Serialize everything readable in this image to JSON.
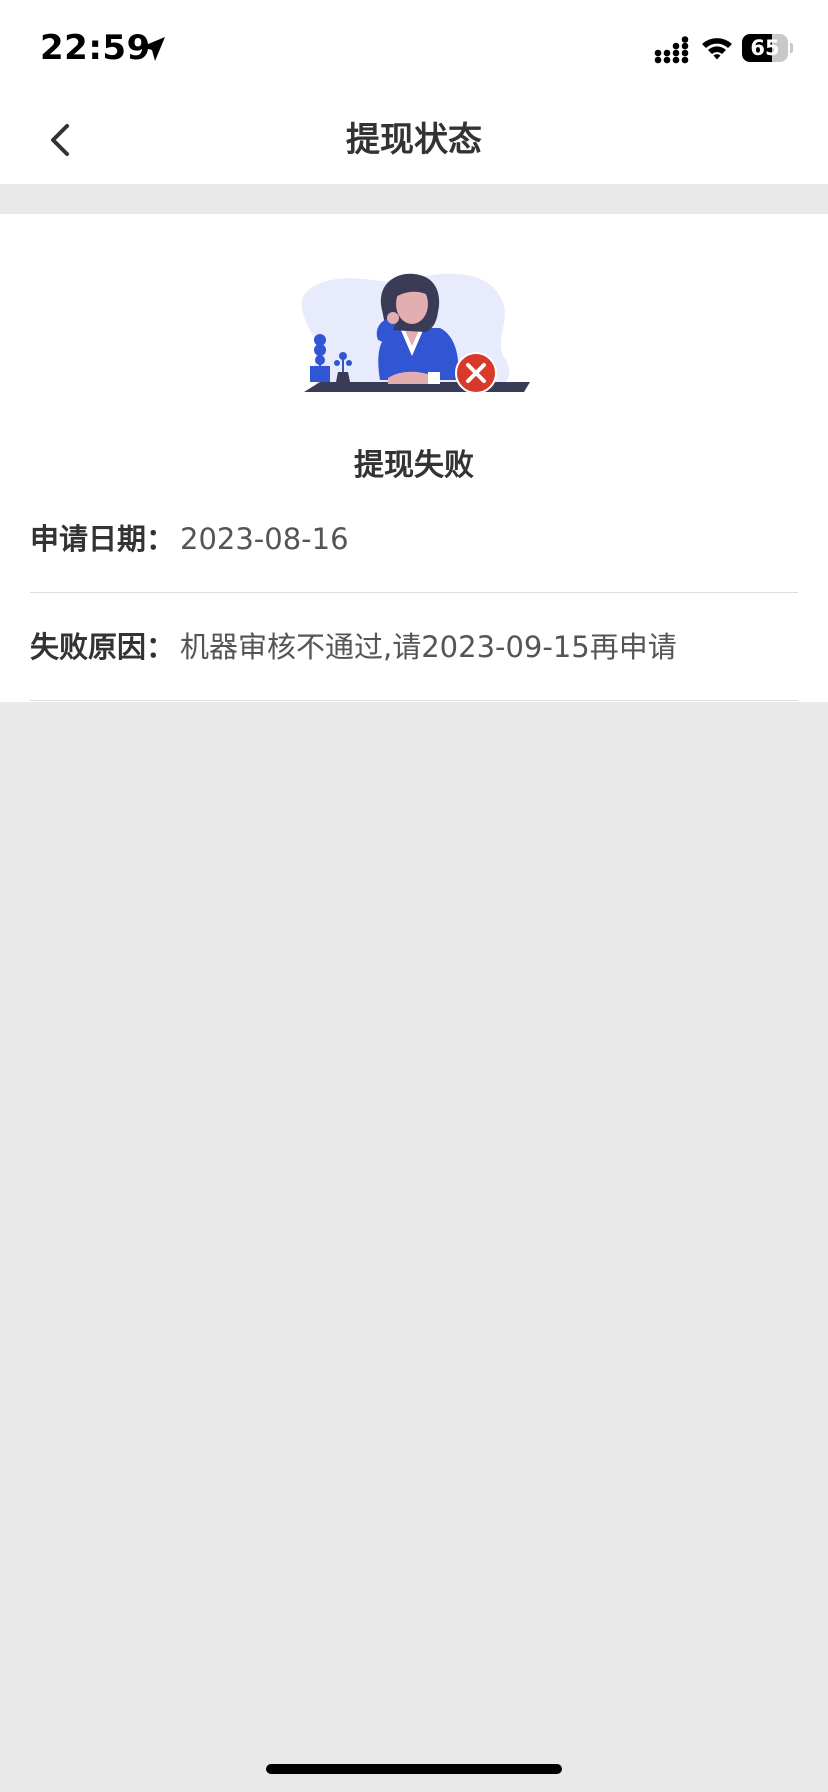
{
  "status_bar": {
    "time": "22:59",
    "battery_level": "65",
    "battery_percent": 65,
    "icons": [
      "location-arrow-icon",
      "cellular-signal-icon",
      "wifi-icon",
      "battery-icon"
    ]
  },
  "header": {
    "title": "提现状态",
    "back_icon": "chevron-left-icon"
  },
  "result": {
    "illustration": "failed-woman-illustration",
    "status_icon": "error-x-icon",
    "title": "提现失败"
  },
  "details": [
    {
      "label": "申请日期：",
      "value": "2023-08-16"
    },
    {
      "label": "失败原因：",
      "value": "机器审核不通过,请2023-09-15再申请"
    }
  ],
  "colors": {
    "page_background": "#e9e9e9",
    "card_background": "#ffffff",
    "accent_blue": "#3156d3",
    "error_red": "#d8392b",
    "text_primary": "#333333",
    "text_secondary": "#555555"
  }
}
